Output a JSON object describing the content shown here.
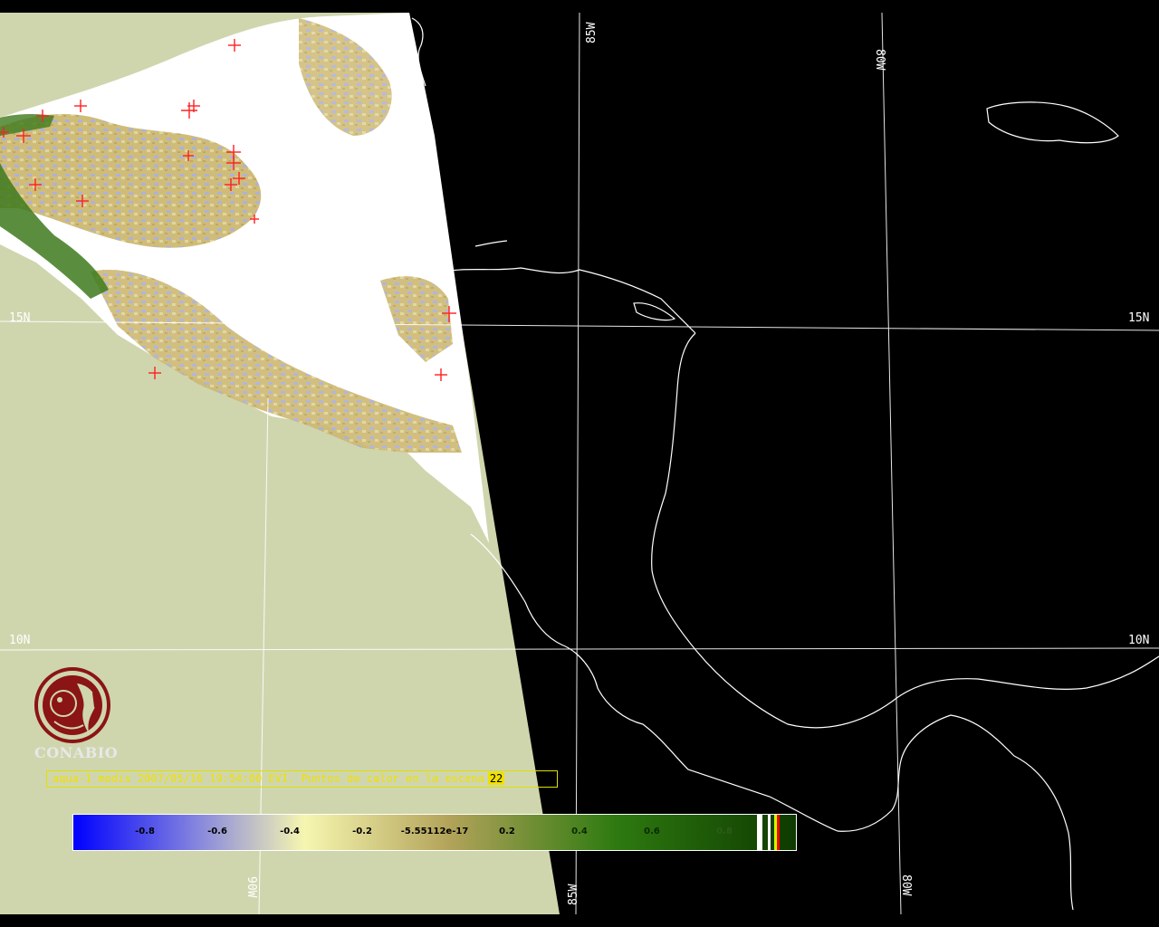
{
  "map": {
    "grid_labels": {
      "lat_15_left": "15N",
      "lat_15_right": "15N",
      "lat_10_left": "10N",
      "lat_10_right": "10N",
      "lon_85_top": "85W",
      "lon_80_top": "80W",
      "lon_90_bottom": "90W",
      "lon_85_bottom": "85W",
      "lon_80_bottom": "80W"
    },
    "colors": {
      "background": "#000000",
      "no_data_land_sea": "#cfd6ae",
      "cloud": "#ffffff",
      "coastline": "#ffffff",
      "gridline": "#ffffff",
      "hotspot_marker": "#ff2020",
      "caption_text": "#f0e000"
    },
    "hotspot_marker_icon": "red-cross-icon"
  },
  "logo": {
    "text": "CONABIO",
    "icon": "conabio-macaw-logo",
    "color": "#8b1414"
  },
  "caption": {
    "text": "aqua-1 modis 2007/05/16 19:54:00 EVI. Puntos de calor en la escena",
    "count": "22"
  },
  "legend": {
    "ticks": [
      "-0.8",
      "-0.6",
      "-0.4",
      "-0.2",
      "-5.55112e-17",
      "0.2",
      "0.4",
      "0.6",
      "0.8"
    ],
    "gradient_colors": [
      "#0000ff",
      "#8c8cdc",
      "#f6f6b0",
      "#b3a35a",
      "#2e7a10",
      "#0e3a00"
    ],
    "flag_colors": [
      "#ffffff",
      "#ffffff",
      "#c8ff00",
      "#ff0000"
    ]
  }
}
